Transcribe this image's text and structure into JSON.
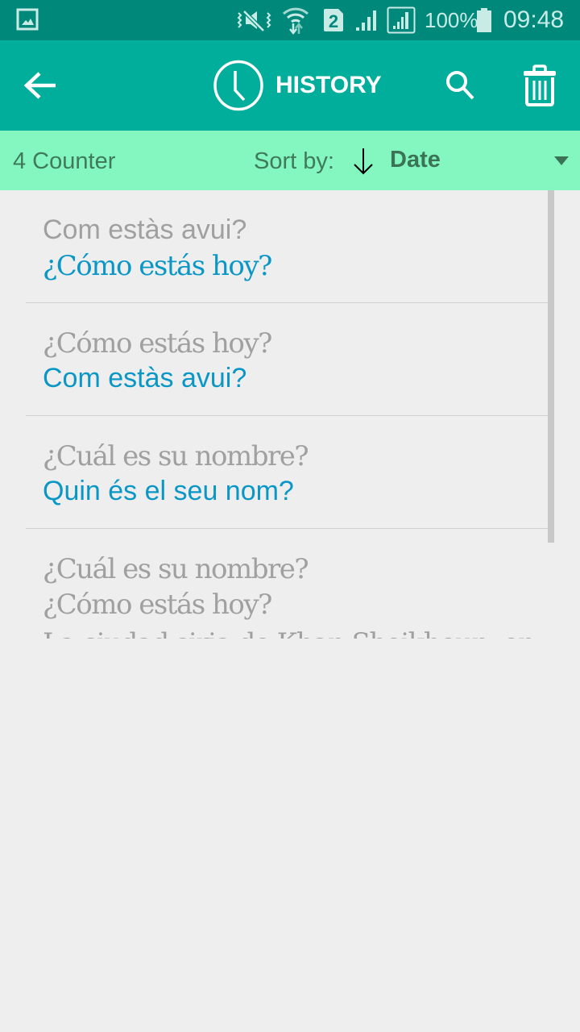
{
  "status_bar": {
    "icons": [
      "gallery-icon",
      "vibrate-mute-icon",
      "wifi-icon",
      "sim-2-icon",
      "signal-icon",
      "signal-sim2-icon",
      "battery-icon"
    ],
    "sim_number": "2",
    "battery_percent": "100%",
    "clock": "09:48",
    "background_color": "#00897b"
  },
  "app_bar": {
    "title": "HISTORY",
    "back_icon": "arrow-left-icon",
    "title_icon": "clock-icon",
    "search_icon": "search-icon",
    "delete_icon": "trash-icon",
    "background_color": "#00ae9b"
  },
  "sort_bar": {
    "counter": "4 Counter",
    "sort_label": "Sort by:",
    "sort_direction": "descending",
    "sort_direction_glyph": "↓",
    "sort_value": "Date",
    "background_color": "#84f7c1"
  },
  "history": {
    "items": [
      {
        "source": "Com estàs avui?",
        "translation": "¿Cómo estás hoy?"
      },
      {
        "source": "¿Cómo estás hoy?",
        "translation": "Com estàs avui?"
      },
      {
        "source": "¿Cuál es su nombre?",
        "translation": "Quin és el seu nom?"
      },
      {
        "source": "¿Cuál es su nombre?",
        "translation": "¿Cómo estás hoy?",
        "extra": "La ciudad siria de Khan Sheikhoun, en"
      }
    ],
    "translation_color": "#0b97c6",
    "source_color": "#a0a0a0"
  }
}
